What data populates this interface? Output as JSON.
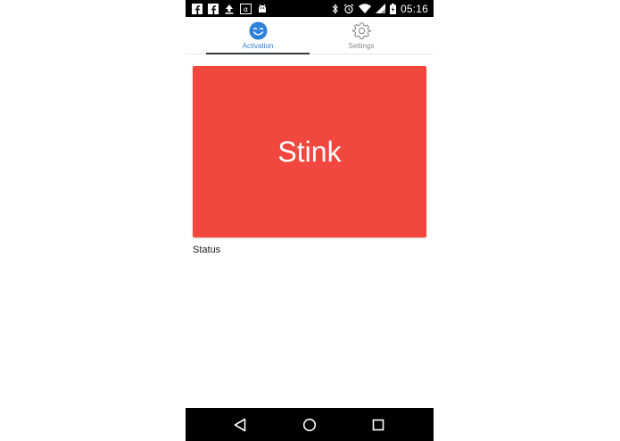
{
  "status_bar": {
    "time": "05:16",
    "left_icons": [
      "facebook-icon",
      "facebook-icon",
      "upload-icon",
      "alpha-app-icon",
      "android-icon"
    ],
    "right_icons": [
      "bluetooth-icon",
      "alarm-icon",
      "wifi-icon",
      "signal-icon",
      "battery-icon"
    ]
  },
  "tabs": [
    {
      "label": "Activation",
      "icon": "smiley-icon",
      "active": true,
      "color": "#2f80d8"
    },
    {
      "label": "Settings",
      "icon": "gear-icon",
      "active": false,
      "color": "#8a8a8a"
    }
  ],
  "main": {
    "action_button_label": "Stink",
    "action_button_color": "#f2473e",
    "status_label": "Status"
  },
  "nav_bar": {
    "buttons": [
      "back-icon",
      "home-icon",
      "recents-icon"
    ]
  }
}
